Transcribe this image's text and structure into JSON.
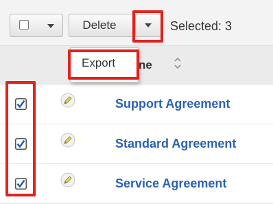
{
  "toolbar": {
    "delete_label": "Delete",
    "selected_text": "Selected: 3",
    "highlight_color": "#e4211b"
  },
  "list_header": {
    "column_partial": "ne",
    "sort_icon": "sort-both-icon"
  },
  "actions_menu": {
    "items": [
      "Export"
    ]
  },
  "rows": [
    {
      "name": "Support Agreement",
      "checked": true,
      "edit_icon": "pencil-icon"
    },
    {
      "name": "Standard Agreement",
      "checked": true,
      "edit_icon": "pencil-icon"
    },
    {
      "name": "Service Agreement",
      "checked": true,
      "edit_icon": "pencil-icon"
    }
  ],
  "colors": {
    "link": "#2b62b4",
    "header_bg": "#ebebeb",
    "toolbar_bg": "#f3f3f3"
  }
}
